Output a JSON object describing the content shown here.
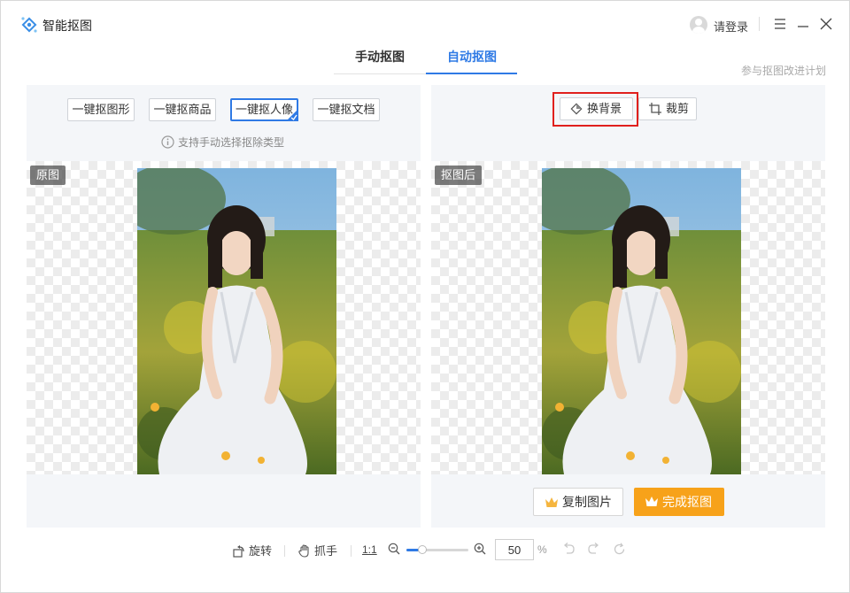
{
  "app": {
    "title": "智能抠图",
    "login_label": "请登录"
  },
  "tabs": [
    {
      "label": "手动抠图",
      "active": false
    },
    {
      "label": "自动抠图",
      "active": true
    }
  ],
  "plan_link": "参与抠图改进计划",
  "left_panel": {
    "options": [
      {
        "label": "一键抠图形",
        "selected": false
      },
      {
        "label": "一键抠商品",
        "selected": false
      },
      {
        "label": "一键抠人像",
        "selected": true
      },
      {
        "label": "一键抠文档",
        "selected": false
      }
    ],
    "hint": "支持手动选择抠除类型",
    "tag": "原图"
  },
  "right_panel": {
    "tools": [
      {
        "label": "换背景",
        "icon": "diamond-icon"
      },
      {
        "label": "裁剪",
        "icon": "crop-icon"
      }
    ],
    "tag": "抠图后",
    "copy_label": "复制图片",
    "finish_label": "完成抠图"
  },
  "bottom_bar": {
    "rotate_label": "旋转",
    "grab_label": "抓手",
    "ratio_label": "1:1",
    "zoom_value": "50",
    "zoom_unit": "%",
    "zoom_fraction": 0.25
  },
  "colors": {
    "accent": "#2f7ae5",
    "highlight": "#e0201d",
    "finish": "#f7a21a"
  }
}
